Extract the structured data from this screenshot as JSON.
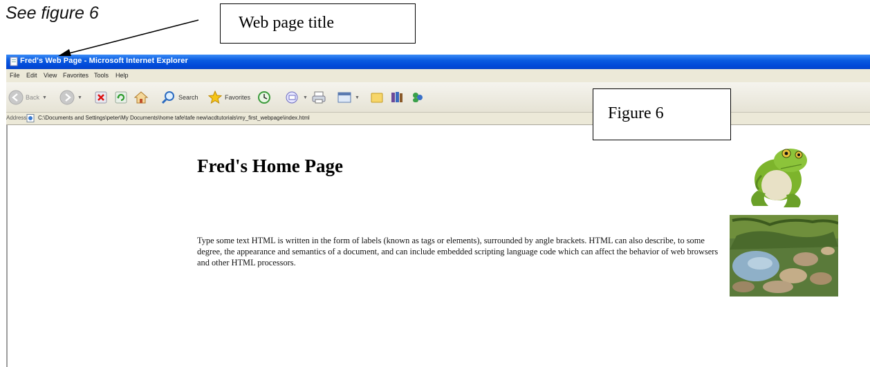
{
  "annotations": {
    "see_figure": "See figure 6",
    "title_callout": "Web page title",
    "figure_callout": "Figure 6"
  },
  "browser": {
    "title": "Fred's Web Page - Microsoft Internet Explorer",
    "menu": [
      "File",
      "Edit",
      "View",
      "Favorites",
      "Tools",
      "Help"
    ],
    "toolbar": {
      "back": "Back",
      "search": "Search",
      "favorites": "Favorites"
    },
    "address_label": "Address",
    "address": "C:\\Documents and Settings\\peter\\My Documents\\home tafe\\tafe new\\acdtutorials\\my_first_webpage\\index.html"
  },
  "page": {
    "heading": "Fred's Home Page",
    "body": "Type some text HTML is written in the form of labels (known as tags or elements), surrounded by angle brackets. HTML can also describe, to some degree, the appearance and semantics of a document, and can include embedded scripting language code which can affect the behavior of web browsers and other HTML processors."
  },
  "colors": {
    "titlebar": "#0a5ae0",
    "window_chrome": "#ece9d8"
  }
}
